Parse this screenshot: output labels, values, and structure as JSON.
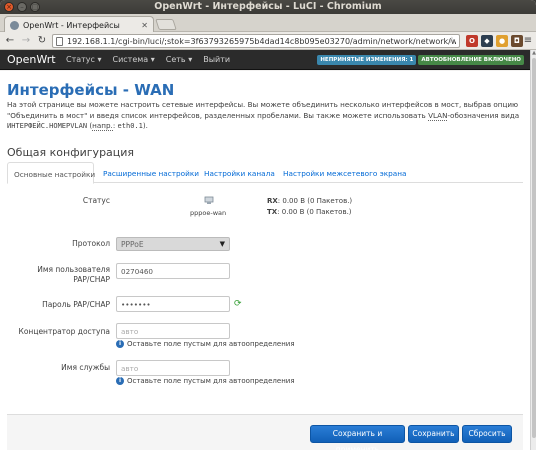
{
  "window": {
    "title": "OpenWrt - Интерфейсы - LuCI - Chromium"
  },
  "browser": {
    "tab_title": "OpenWrt - Интерфейсы",
    "url": "192.168.1.1/cgi-bin/luci/;stok=3f63793265975b4dad14c8b095e03270/admin/network/network/wan"
  },
  "header": {
    "brand": "OpenWrt",
    "menu": [
      "Статус ▾",
      "Система ▾",
      "Сеть ▾",
      "Выйти"
    ],
    "badge_changes": "НЕПРИНЯТЫЕ ИЗМЕНЕНИЯ: 1",
    "badge_autorefresh": "АВТООБНОВЛЕНИЕ ВКЛЮЧЕНО"
  },
  "page": {
    "title": "Интерфейсы - WAN",
    "desc_1": "На этой странице вы можете настроить сетевые интерфейсы. Вы можете объединить несколько интерфейсов в мост, выбрав опцию \"Объединить в мост\" и введя список интерфейсов, разделенных пробелами. Вы также можете использовать ",
    "desc_vlan": "VLAN",
    "desc_2": "-обозначения вида ",
    "desc_code": "ИНТЕРФЕЙС.НОМЕРVLAN",
    "desc_3": " (",
    "desc_example": "напр.",
    "desc_4": ": ",
    "desc_code2": "eth0.1",
    "desc_5": ").",
    "section_title": "Общая конфигурация"
  },
  "tabs": [
    "Основные настройки",
    "Расширенные настройки",
    "Настройки канала",
    "Настройки межсетевого экрана"
  ],
  "form": {
    "status_label": "Статус",
    "status_device": "pppoe-wan",
    "rx_label": "RX",
    "rx_value": ": 0.00 B (0 Пакетов.)",
    "tx_label": "TX",
    "tx_value": ": 0.00 B (0 Пакетов.)",
    "protocol_label": "Протокол",
    "protocol_value": "PPPoE",
    "username_label_1": "Имя пользователя",
    "username_label_2": "PAP/CHAP",
    "username_value": "0270460",
    "password_label": "Пароль PAP/CHAP",
    "password_value": "•••••••",
    "ac_label": "Концентратор доступа",
    "ac_placeholder": "авто",
    "ac_hint": "Оставьте поле пустым для автоопределения",
    "service_label": "Имя службы",
    "service_placeholder": "авто",
    "service_hint": "Оставьте поле пустым для автоопределения"
  },
  "actions": {
    "save_apply": "Сохранить и применить",
    "save": "Сохранить",
    "reset": "Сбросить"
  },
  "colors": {
    "accent": "#2a6db5",
    "button": "#1a6fc9",
    "header_bg": "#2b2b2b"
  }
}
